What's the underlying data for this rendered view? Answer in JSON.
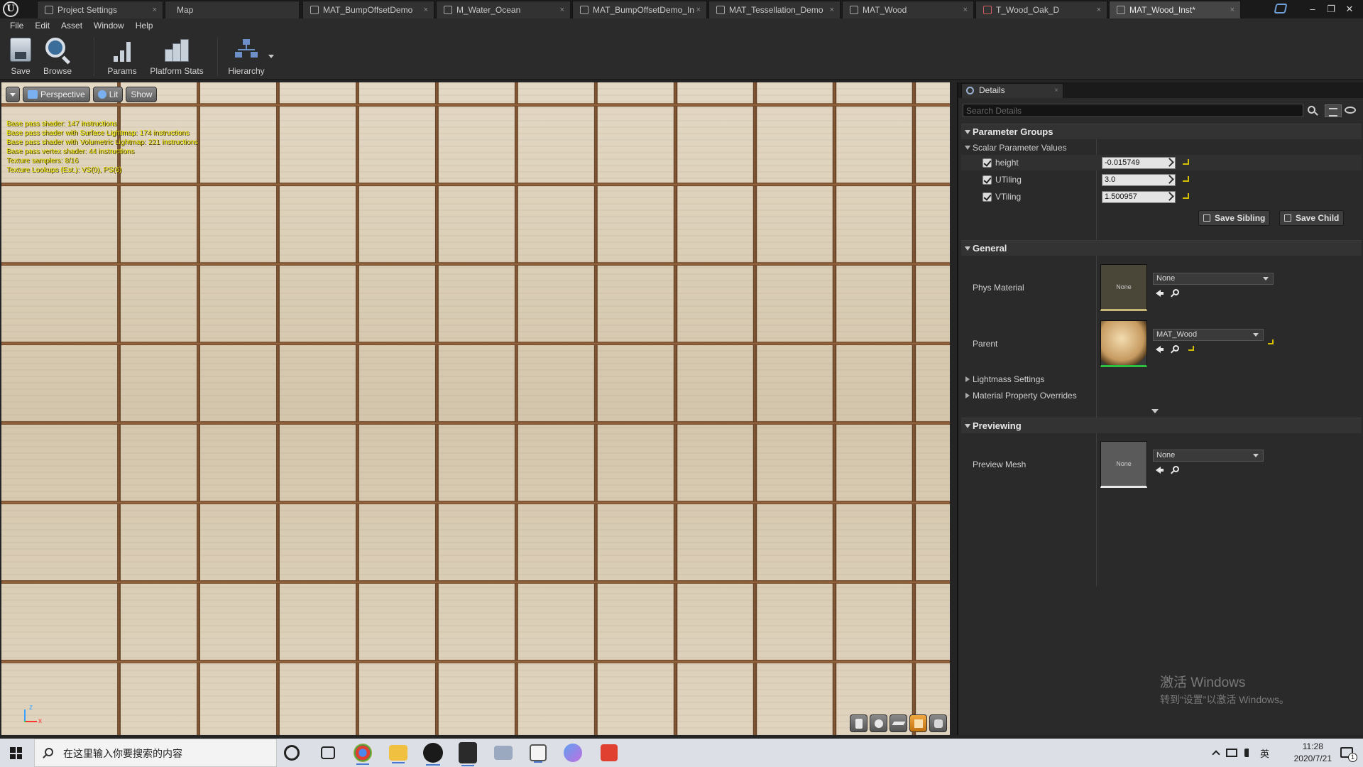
{
  "window": {
    "tabs": [
      {
        "label": "Project Settings",
        "active": false,
        "icon": "settings-icon"
      },
      {
        "label": "Map",
        "active": false,
        "icon": "none"
      },
      {
        "label": "MAT_BumpOffsetDemo",
        "active": false,
        "icon": "material-icon"
      },
      {
        "label": "M_Water_Ocean",
        "active": false,
        "icon": "material-icon"
      },
      {
        "label": "MAT_BumpOffsetDemo_In",
        "active": false,
        "icon": "material-instance-icon"
      },
      {
        "label": "MAT_Tessellation_Demo",
        "active": false,
        "icon": "material-icon"
      },
      {
        "label": "MAT_Wood",
        "active": false,
        "icon": "material-icon"
      },
      {
        "label": "T_Wood_Oak_D",
        "active": false,
        "icon": "texture-icon"
      },
      {
        "label": "MAT_Wood_Inst*",
        "active": true,
        "icon": "material-instance-icon"
      }
    ],
    "close_glyph": "×",
    "controls": {
      "minimize": "–",
      "restore": "❐",
      "close": "✕"
    }
  },
  "menu": [
    "File",
    "Edit",
    "Asset",
    "Window",
    "Help"
  ],
  "toolbar": {
    "save": "Save",
    "browse": "Browse",
    "params": "Params",
    "platform_stats": "Platform Stats",
    "hierarchy": "Hierarchy"
  },
  "viewport": {
    "view_mode": "Perspective",
    "lighting": "Lit",
    "show": "Show",
    "stats": [
      "Base pass shader: 147 instructions",
      "Base pass shader with Surface Lightmap: 174 instructions",
      "Base pass shader with Volumetric Lightmap: 221 instructions",
      "Base pass vertex shader: 44 instructions",
      "Texture samplers: 8/16",
      "Texture Lookups (Est.): VS(0), PS(6)"
    ],
    "axis": {
      "z": "z",
      "x": "x"
    }
  },
  "details": {
    "tab_label": "Details",
    "search_placeholder": "Search Details",
    "parameter_groups": "Parameter Groups",
    "scalar_values": "Scalar Parameter Values",
    "params": [
      {
        "name": "height",
        "value": "-0.015749",
        "enabled": true
      },
      {
        "name": "UTiling",
        "value": "3.0",
        "enabled": true
      },
      {
        "name": "VTiling",
        "value": "1.500957",
        "enabled": true
      }
    ],
    "save_sibling": "Save Sibling",
    "save_child": "Save Child",
    "general": "General",
    "phys_material_label": "Phys Material",
    "phys_material_thumb": "None",
    "phys_material_value": "None",
    "parent_label": "Parent",
    "parent_value": "MAT_Wood",
    "lightmass": "Lightmass Settings",
    "material_overrides": "Material Property Overrides",
    "previewing": "Previewing",
    "preview_mesh_label": "Preview Mesh",
    "preview_mesh_thumb": "None",
    "preview_mesh_value": "None"
  },
  "watermark": {
    "title": "激活 Windows",
    "subtitle": "转到“设置”以激活 Windows。"
  },
  "taskbar": {
    "search_placeholder": "在这里输入你要搜索的内容",
    "ime": "英",
    "time": "11:28",
    "date": "2020/7/21",
    "notifications": "1"
  }
}
